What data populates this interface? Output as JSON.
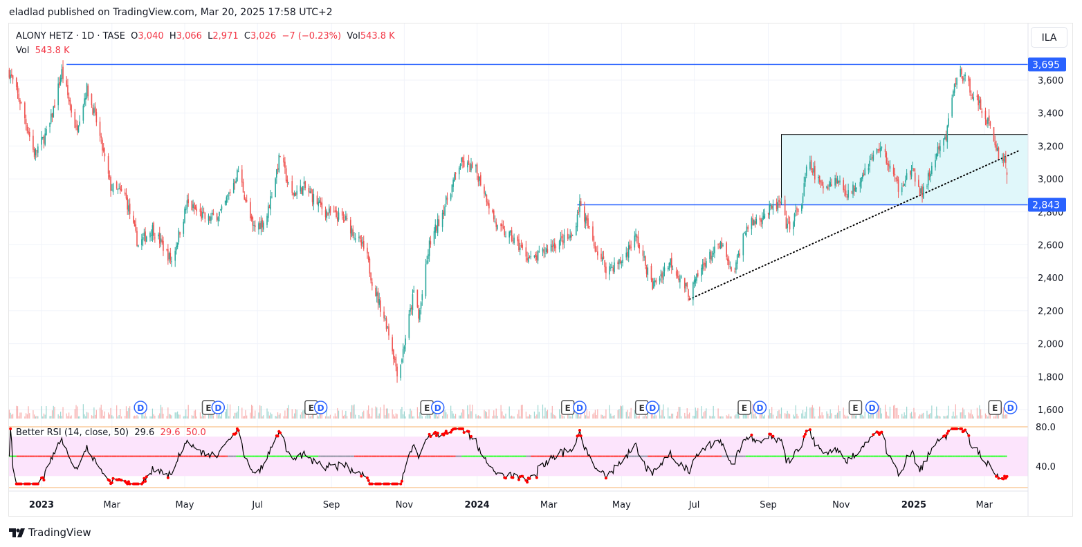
{
  "header": {
    "published": "eladlad published on TradingView.com, Mar 20, 2025 17:58 UTC+2"
  },
  "legend": {
    "symbol": "ALONY HETZ · 1D · TASE",
    "o_label": "O",
    "open": "3,040",
    "h_label": "H",
    "high": "3,066",
    "l_label": "L",
    "low": "2,971",
    "c_label": "C",
    "close": "3,026",
    "change": "−7 (−0.23%)",
    "vol_label": "Vol",
    "vol": "543.8 K"
  },
  "volume_legend": {
    "label": "Vol",
    "value": "543.8 K"
  },
  "currency": "ILA",
  "rsi_legend": {
    "name": "Better RSI (14, close, 50)",
    "v1": "29.6",
    "v2": "29.6",
    "v3": "50.0"
  },
  "footer": {
    "brand": "TradingView"
  },
  "colors": {
    "up": "#26a69a",
    "down": "#ef5350",
    "line": "#2962ff",
    "box": "#e0f7fa",
    "rsi_band": "#fce4fc"
  },
  "chart_data": {
    "type": "candlestick",
    "title": "ALONY HETZ · 1D · TASE",
    "price_axis": {
      "ticks": [
        "3,600",
        "3,400",
        "3,200",
        "3,000",
        "2,800",
        "2,600",
        "2,400",
        "2,200",
        "2,000",
        "1,800",
        "1,600"
      ],
      "tick_values": [
        3600,
        3400,
        3200,
        3000,
        2800,
        2600,
        2400,
        2200,
        2000,
        1800,
        1600
      ],
      "ylim": [
        1580,
        3760
      ]
    },
    "time_axis": {
      "labels": [
        {
          "t": "2023",
          "date": "2023-01-01",
          "bold": true
        },
        {
          "t": "Mar",
          "date": "2023-03-01"
        },
        {
          "t": "May",
          "date": "2023-05-01"
        },
        {
          "t": "Jul",
          "date": "2023-07-01"
        },
        {
          "t": "Sep",
          "date": "2023-09-01"
        },
        {
          "t": "Nov",
          "date": "2023-11-01"
        },
        {
          "t": "2024",
          "date": "2024-01-01",
          "bold": true
        },
        {
          "t": "Mar",
          "date": "2024-03-01"
        },
        {
          "t": "May",
          "date": "2024-05-01"
        },
        {
          "t": "Jul",
          "date": "2024-07-01"
        },
        {
          "t": "Sep",
          "date": "2024-09-01"
        },
        {
          "t": "Nov",
          "date": "2024-11-01"
        },
        {
          "t": "2025",
          "date": "2025-01-01",
          "bold": true
        },
        {
          "t": "Mar",
          "date": "2025-03-01"
        }
      ]
    },
    "close_path": [
      [
        "2022-12-05",
        3650
      ],
      [
        "2022-12-15",
        3450
      ],
      [
        "2022-12-26",
        3150
      ],
      [
        "2023-01-07",
        3300
      ],
      [
        "2023-01-18",
        3650
      ],
      [
        "2023-01-30",
        3300
      ],
      [
        "2023-02-08",
        3550
      ],
      [
        "2023-02-16",
        3350
      ],
      [
        "2023-02-28",
        2950
      ],
      [
        "2023-03-12",
        2900
      ],
      [
        "2023-03-23",
        2600
      ],
      [
        "2023-04-04",
        2700
      ],
      [
        "2023-04-20",
        2500
      ],
      [
        "2023-05-03",
        2850
      ],
      [
        "2023-05-20",
        2750
      ],
      [
        "2023-06-01",
        2800
      ],
      [
        "2023-06-15",
        3050
      ],
      [
        "2023-06-27",
        2700
      ],
      [
        "2023-07-08",
        2750
      ],
      [
        "2023-07-20",
        3150
      ],
      [
        "2023-07-29",
        2900
      ],
      [
        "2023-08-09",
        2950
      ],
      [
        "2023-08-27",
        2800
      ],
      [
        "2023-09-13",
        2750
      ],
      [
        "2023-09-30",
        2550
      ],
      [
        "2023-10-06",
        2350
      ],
      [
        "2023-10-18",
        2100
      ],
      [
        "2023-10-27",
        1800
      ],
      [
        "2023-11-01",
        2000
      ],
      [
        "2023-11-10",
        2350
      ],
      [
        "2023-11-13",
        2150
      ],
      [
        "2023-11-22",
        2600
      ],
      [
        "2023-12-03",
        2800
      ],
      [
        "2023-12-18",
        3100
      ],
      [
        "2023-12-31",
        3050
      ],
      [
        "2024-01-06",
        2950
      ],
      [
        "2024-01-18",
        2700
      ],
      [
        "2024-01-29",
        2650
      ],
      [
        "2024-02-16",
        2500
      ],
      [
        "2024-03-04",
        2600
      ],
      [
        "2024-03-21",
        2650
      ],
      [
        "2024-03-27",
        2850
      ],
      [
        "2024-04-08",
        2600
      ],
      [
        "2024-04-19",
        2450
      ],
      [
        "2024-05-01",
        2500
      ],
      [
        "2024-05-13",
        2650
      ],
      [
        "2024-05-27",
        2350
      ],
      [
        "2024-06-11",
        2500
      ],
      [
        "2024-06-27",
        2300
      ],
      [
        "2024-07-10",
        2500
      ],
      [
        "2024-07-24",
        2600
      ],
      [
        "2024-08-02",
        2400
      ],
      [
        "2024-08-13",
        2700
      ],
      [
        "2024-08-31",
        2800
      ],
      [
        "2024-09-11",
        2850
      ],
      [
        "2024-09-17",
        2700
      ],
      [
        "2024-09-29",
        2850
      ],
      [
        "2024-10-04",
        3100
      ],
      [
        "2024-10-16",
        2950
      ],
      [
        "2024-10-28",
        3000
      ],
      [
        "2024-11-08",
        2900
      ],
      [
        "2024-11-20",
        3050
      ],
      [
        "2024-12-04",
        3200
      ],
      [
        "2024-12-19",
        2950
      ],
      [
        "2024-12-30",
        3050
      ],
      [
        "2025-01-08",
        2900
      ],
      [
        "2025-01-20",
        3150
      ],
      [
        "2025-01-28",
        3250
      ],
      [
        "2025-02-03",
        3550
      ],
      [
        "2025-02-09",
        3650
      ],
      [
        "2025-02-21",
        3500
      ],
      [
        "2025-03-04",
        3350
      ],
      [
        "2025-03-13",
        3150
      ],
      [
        "2025-03-19",
        3100
      ],
      [
        "2025-03-20",
        3026
      ]
    ],
    "drawings": {
      "hlines": [
        {
          "price": 3695,
          "label": "3,695",
          "from": "2023-01-22"
        },
        {
          "price": 2843,
          "label": "2,843",
          "from": "2024-03-25"
        }
      ],
      "box": {
        "from": "2024-09-12",
        "top": 3270,
        "bottom": 2843
      },
      "trendline": {
        "from": [
          "2024-06-27",
          2270
        ],
        "to": [
          "2025-03-31",
          3175
        ],
        "style": "dotted"
      }
    },
    "events": [
      {
        "type": "D",
        "date": "2023-03-25"
      },
      {
        "type": "E",
        "date": "2023-05-21"
      },
      {
        "type": "D",
        "date": "2023-05-29"
      },
      {
        "type": "E",
        "date": "2023-08-15"
      },
      {
        "type": "D",
        "date": "2023-08-23"
      },
      {
        "type": "E",
        "date": "2023-11-20"
      },
      {
        "type": "D",
        "date": "2023-11-29"
      },
      {
        "type": "E",
        "date": "2024-03-17"
      },
      {
        "type": "D",
        "date": "2024-03-27"
      },
      {
        "type": "E",
        "date": "2024-05-18"
      },
      {
        "type": "D",
        "date": "2024-05-27"
      },
      {
        "type": "E",
        "date": "2024-08-12"
      },
      {
        "type": "D",
        "date": "2024-08-25"
      },
      {
        "type": "E",
        "date": "2024-11-13"
      },
      {
        "type": "D",
        "date": "2024-11-27"
      },
      {
        "type": "E",
        "date": "2025-03-10"
      },
      {
        "type": "D",
        "date": "2025-03-23"
      }
    ],
    "rsi": {
      "period": 14,
      "ma": 50,
      "levels": [
        80,
        70,
        50,
        30
      ],
      "axis_ticks": [
        "80.0",
        "40.0"
      ],
      "axis_values": [
        80,
        40
      ],
      "last": 29.6
    }
  }
}
